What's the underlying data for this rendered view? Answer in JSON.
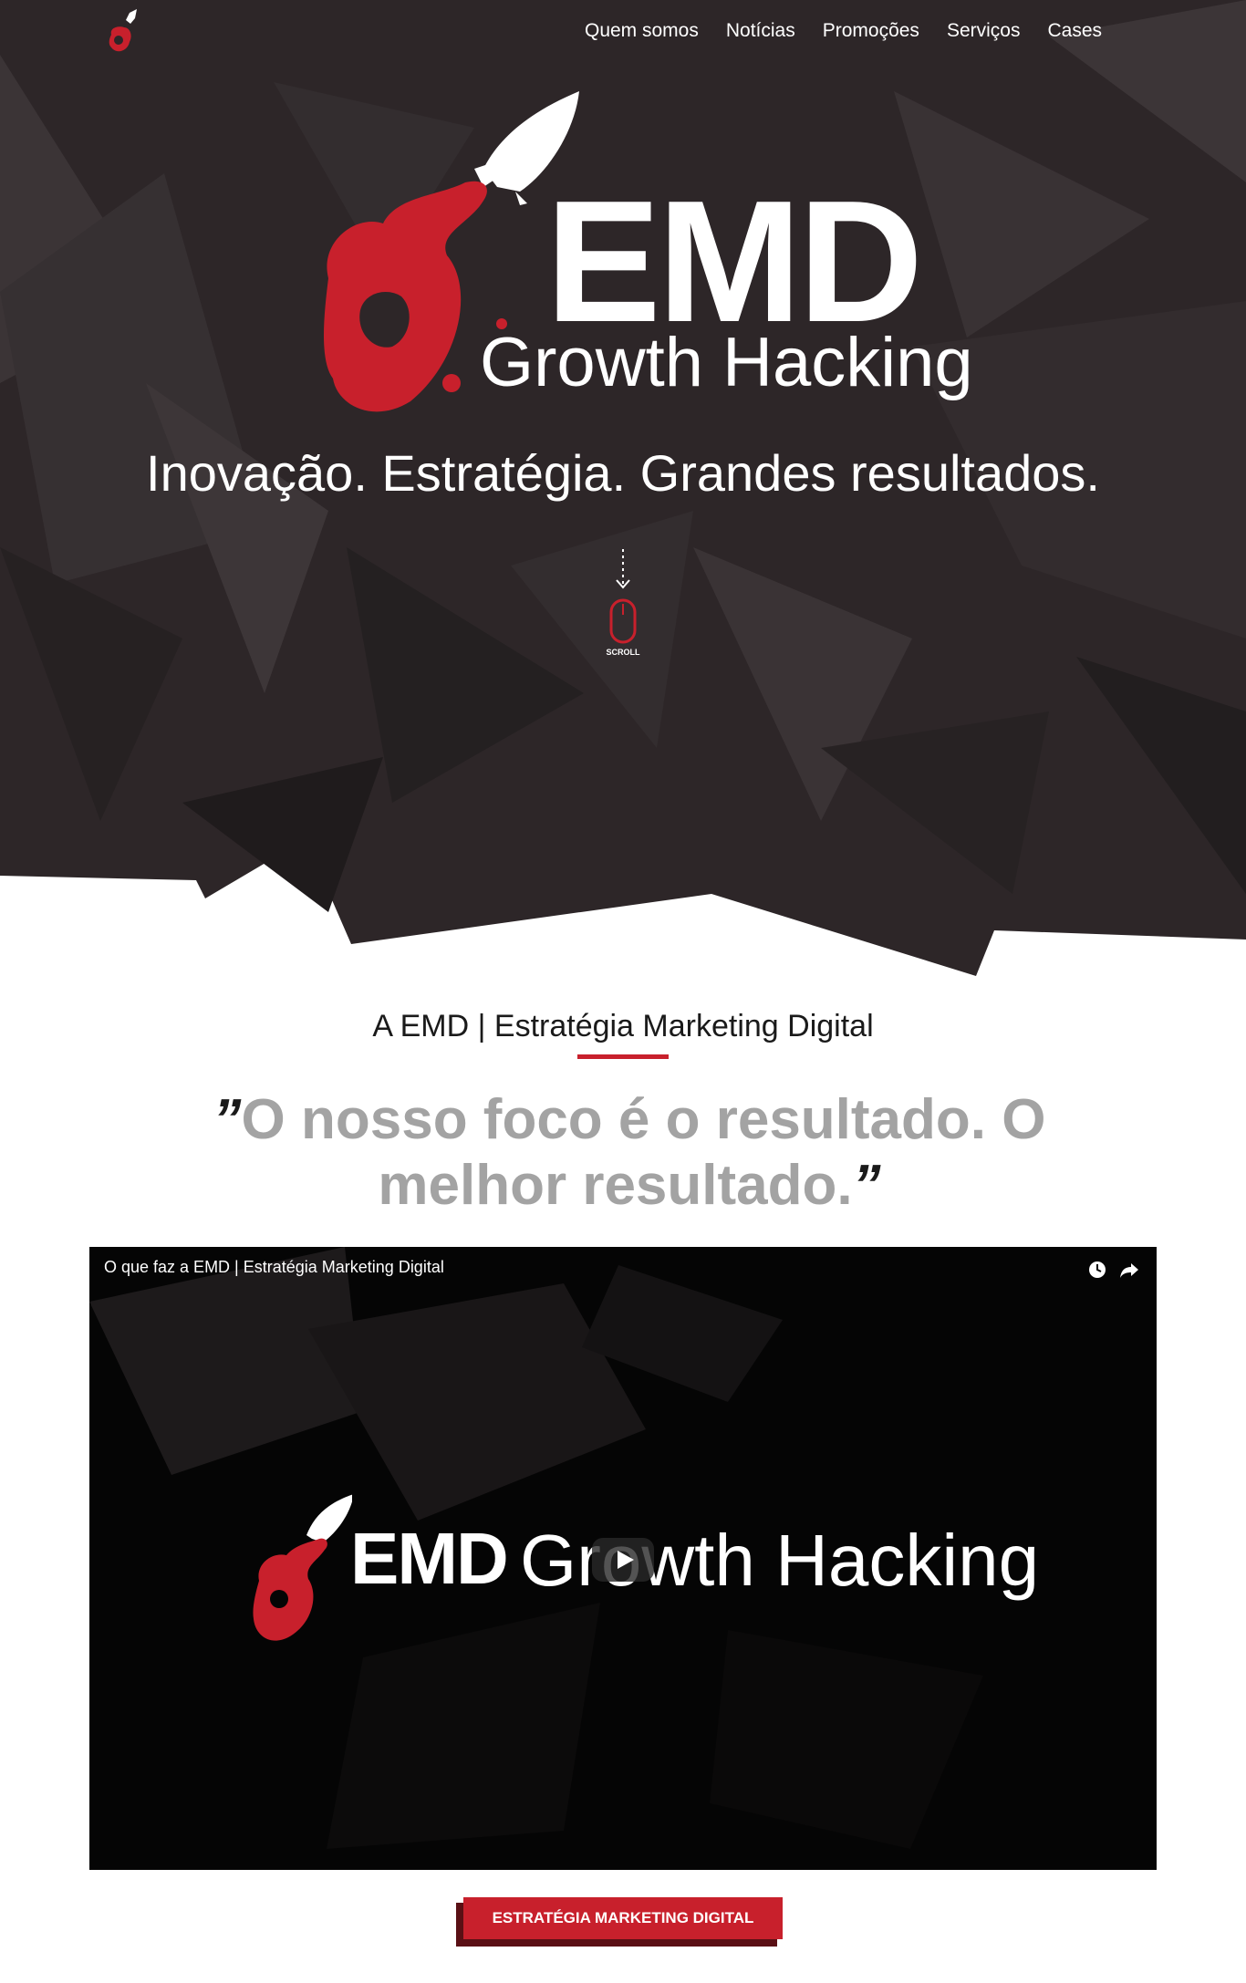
{
  "nav": {
    "items": [
      {
        "label": "Quem somos"
      },
      {
        "label": "Notícias"
      },
      {
        "label": "Promoções"
      },
      {
        "label": "Serviços"
      },
      {
        "label": "Cases"
      }
    ]
  },
  "hero": {
    "brand": "EMD",
    "brand_sub": "Growth Hacking",
    "tagline": "Inovação. Estratégia. Grandes resultados.",
    "scroll_label": "SCROLL"
  },
  "about": {
    "title": "A EMD | Estratégia Marketing Digital",
    "quote": "O nosso foco é o resultado. O melhor resultado.",
    "quote_open": "”",
    "quote_close": "”"
  },
  "video": {
    "title": "O que faz a EMD | Estratégia Marketing Digital",
    "overlay_brand": "EMD",
    "overlay_sub": "Growth Hacking"
  },
  "cta": {
    "label": "ESTRATÉGIA MARKETING DIGITAL"
  },
  "colors": {
    "accent": "#c8202c",
    "hero_bg": "#2d2628",
    "quote_gray": "#a3a3a3"
  }
}
